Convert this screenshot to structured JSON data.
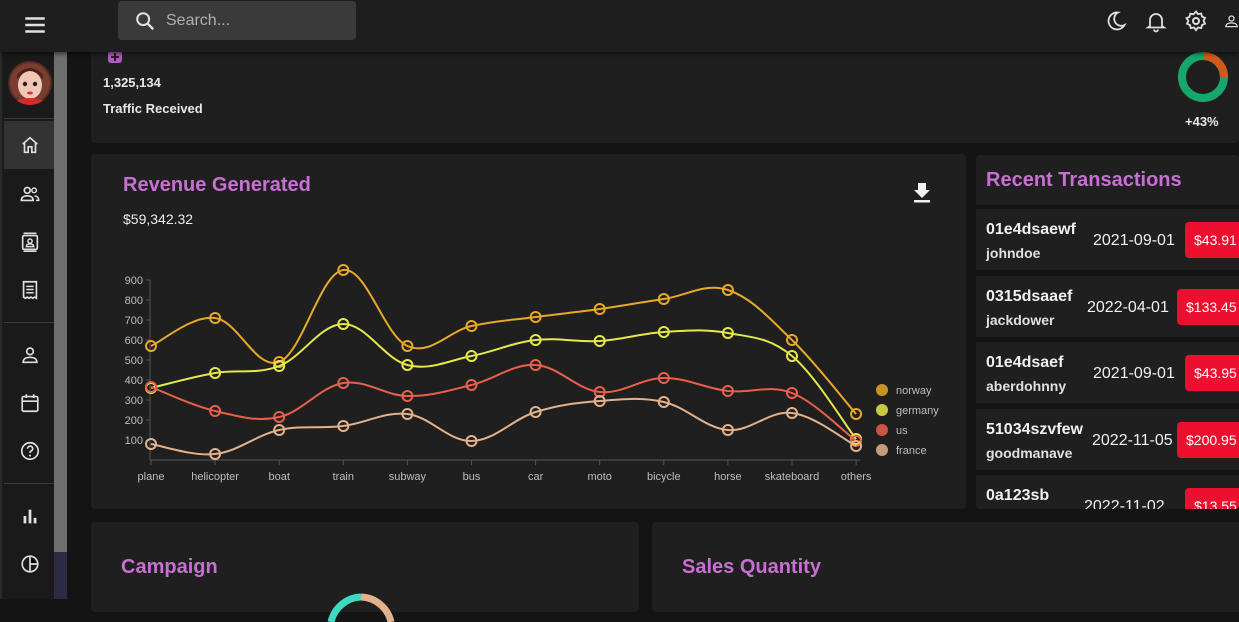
{
  "search": {
    "placeholder": "Search..."
  },
  "traffic": {
    "value": "1,325,134",
    "label": "Traffic Received",
    "increase": "+43%",
    "progress": 0.75
  },
  "revenue": {
    "title": "Revenue Generated",
    "amount": "$59,342.32"
  },
  "chart_data": {
    "type": "line",
    "categories": [
      "plane",
      "helicopter",
      "boat",
      "train",
      "subway",
      "bus",
      "car",
      "moto",
      "bicycle",
      "horse",
      "skateboard",
      "others"
    ],
    "ylim": [
      0,
      1000
    ],
    "yticks": [
      100,
      200,
      300,
      400,
      500,
      600,
      700,
      800,
      900
    ],
    "series": [
      {
        "name": "norway",
        "color": "#e8a926",
        "values": [
          570,
          710,
          490,
          950,
          570,
          670,
          715,
          755,
          805,
          850,
          600,
          230
        ]
      },
      {
        "name": "germany",
        "color": "#e5e84a",
        "values": [
          360,
          435,
          470,
          680,
          475,
          520,
          600,
          595,
          640,
          635,
          520,
          105
        ]
      },
      {
        "name": "us",
        "color": "#e8604a",
        "values": [
          365,
          245,
          215,
          385,
          320,
          375,
          475,
          340,
          410,
          345,
          335,
          95
        ]
      },
      {
        "name": "france",
        "color": "#e3b28b",
        "values": [
          80,
          30,
          150,
          170,
          230,
          95,
          240,
          295,
          290,
          150,
          235,
          70
        ]
      }
    ],
    "legend": "right",
    "grid": false
  },
  "transactions": {
    "title": "Recent Transactions",
    "rows": [
      {
        "id": "01e4dsaewf",
        "user": "johndoe",
        "date": "2021-09-01",
        "cost": "$43.91"
      },
      {
        "id": "0315dsaaef",
        "user": "jackdower",
        "date": "2022-04-01",
        "cost": "$133.45"
      },
      {
        "id": "01e4dsaef",
        "user": "aberdohnny",
        "date": "2021-09-01",
        "cost": "$43.95"
      },
      {
        "id": "51034szvfew",
        "user": "goodmanave",
        "date": "2022-11-05",
        "cost": "$200.95"
      },
      {
        "id": "0a123sb",
        "user": "",
        "date": "2022-11-02",
        "cost": "$13.55"
      }
    ]
  },
  "campaign": {
    "title": "Campaign"
  },
  "sales": {
    "title": "Sales Quantity"
  },
  "colors": {
    "accent": "#c86fd4",
    "danger": "#ee0f30",
    "ring_green": "#16a76a",
    "ring_orange": "#d2591c"
  }
}
